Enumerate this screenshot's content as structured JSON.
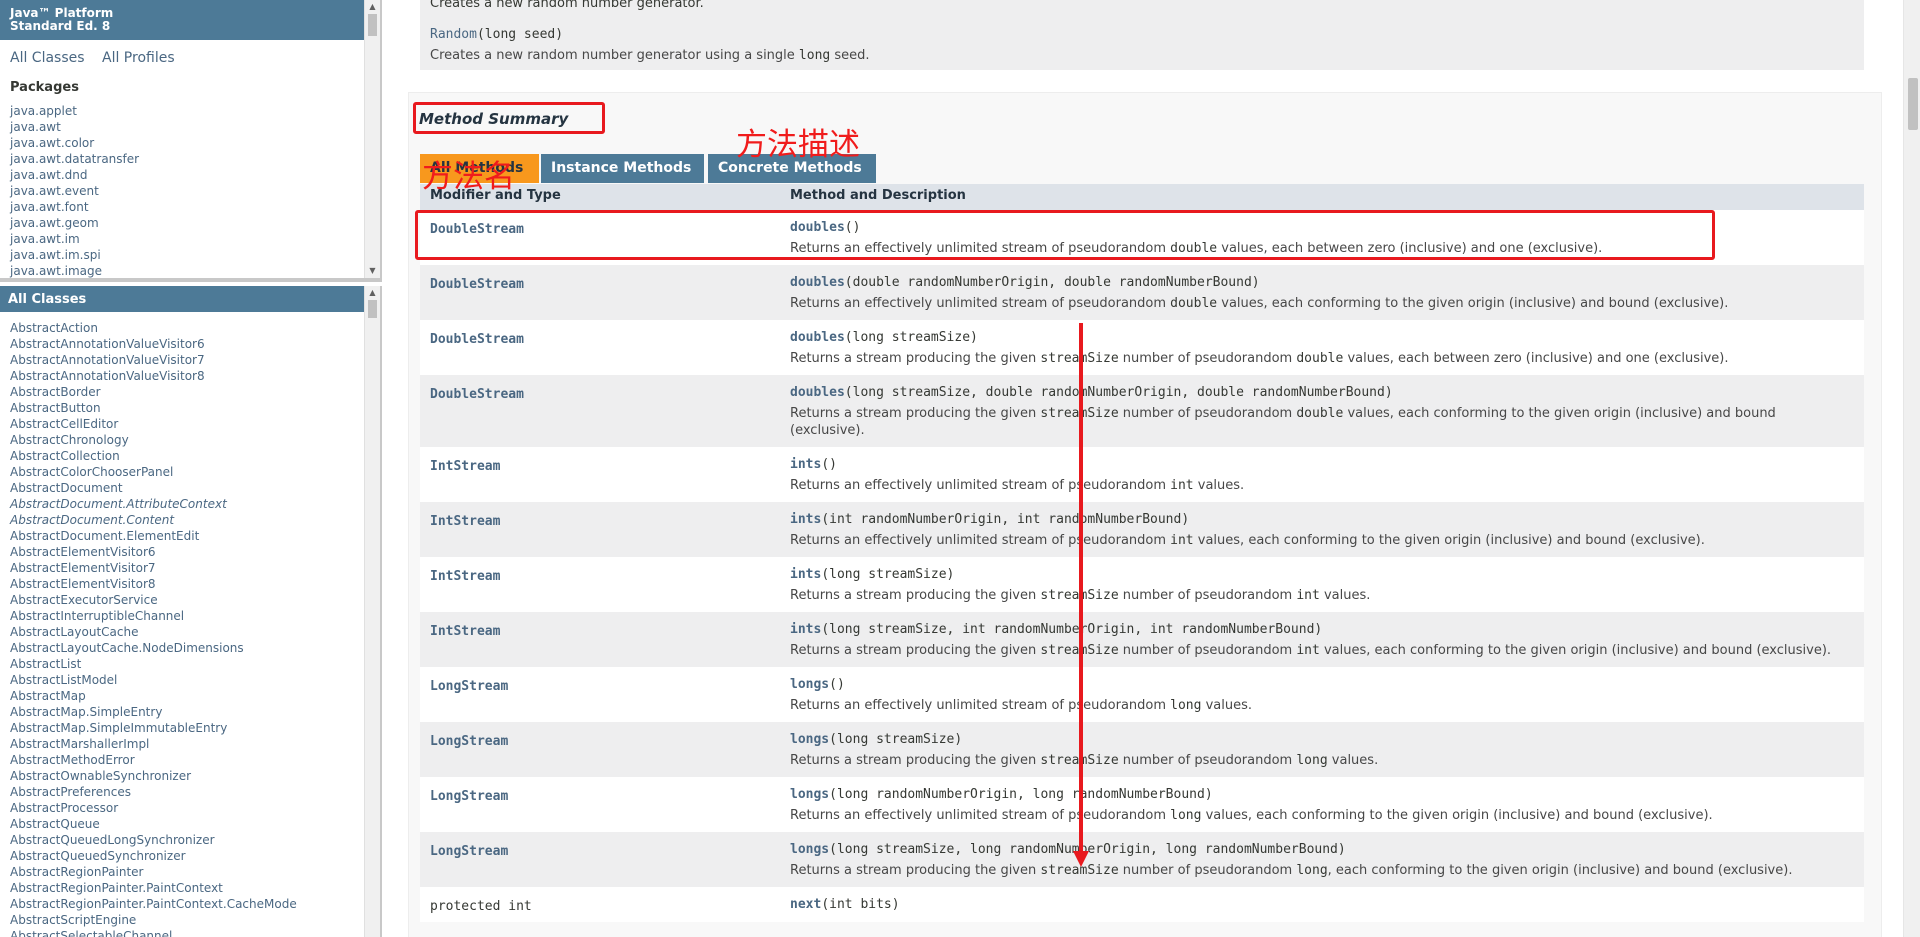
{
  "package_frame": {
    "platform_title_line1": "Java™ Platform",
    "platform_title_line2": "Standard Ed. 8",
    "all_classes_link": "All Classes",
    "all_profiles_link": "All Profiles",
    "packages_heading": "Packages",
    "packages": [
      "java.applet",
      "java.awt",
      "java.awt.color",
      "java.awt.datatransfer",
      "java.awt.dnd",
      "java.awt.event",
      "java.awt.font",
      "java.awt.geom",
      "java.awt.im",
      "java.awt.im.spi",
      "java.awt.image"
    ]
  },
  "class_frame": {
    "heading": "All Classes",
    "classes": [
      {
        "name": "AbstractAction",
        "italic": false
      },
      {
        "name": "AbstractAnnotationValueVisitor6",
        "italic": false
      },
      {
        "name": "AbstractAnnotationValueVisitor7",
        "italic": false
      },
      {
        "name": "AbstractAnnotationValueVisitor8",
        "italic": false
      },
      {
        "name": "AbstractBorder",
        "italic": false
      },
      {
        "name": "AbstractButton",
        "italic": false
      },
      {
        "name": "AbstractCellEditor",
        "italic": false
      },
      {
        "name": "AbstractChronology",
        "italic": false
      },
      {
        "name": "AbstractCollection",
        "italic": false
      },
      {
        "name": "AbstractColorChooserPanel",
        "italic": false
      },
      {
        "name": "AbstractDocument",
        "italic": false
      },
      {
        "name": "AbstractDocument.AttributeContext",
        "italic": true
      },
      {
        "name": "AbstractDocument.Content",
        "italic": true
      },
      {
        "name": "AbstractDocument.ElementEdit",
        "italic": false
      },
      {
        "name": "AbstractElementVisitor6",
        "italic": false
      },
      {
        "name": "AbstractElementVisitor7",
        "italic": false
      },
      {
        "name": "AbstractElementVisitor8",
        "italic": false
      },
      {
        "name": "AbstractExecutorService",
        "italic": false
      },
      {
        "name": "AbstractInterruptibleChannel",
        "italic": false
      },
      {
        "name": "AbstractLayoutCache",
        "italic": false
      },
      {
        "name": "AbstractLayoutCache.NodeDimensions",
        "italic": false
      },
      {
        "name": "AbstractList",
        "italic": false
      },
      {
        "name": "AbstractListModel",
        "italic": false
      },
      {
        "name": "AbstractMap",
        "italic": false
      },
      {
        "name": "AbstractMap.SimpleEntry",
        "italic": false
      },
      {
        "name": "AbstractMap.SimpleImmutableEntry",
        "italic": false
      },
      {
        "name": "AbstractMarshallerImpl",
        "italic": false
      },
      {
        "name": "AbstractMethodError",
        "italic": false
      },
      {
        "name": "AbstractOwnableSynchronizer",
        "italic": false
      },
      {
        "name": "AbstractPreferences",
        "italic": false
      },
      {
        "name": "AbstractProcessor",
        "italic": false
      },
      {
        "name": "AbstractQueue",
        "italic": false
      },
      {
        "name": "AbstractQueuedLongSynchronizer",
        "italic": false
      },
      {
        "name": "AbstractQueuedSynchronizer",
        "italic": false
      },
      {
        "name": "AbstractRegionPainter",
        "italic": false
      },
      {
        "name": "AbstractRegionPainter.PaintContext",
        "italic": false
      },
      {
        "name": "AbstractRegionPainter.PaintContext.CacheMode",
        "italic": false
      },
      {
        "name": "AbstractScriptEngine",
        "italic": false
      },
      {
        "name": "AbstractSelectableChannel",
        "italic": false
      }
    ]
  },
  "constructor": {
    "prev_desc_fragment": "Creates a new random number generator.",
    "name": "Random",
    "params": "(long seed)",
    "desc_before": "Creates a new random number generator using a single ",
    "desc_code": "long",
    "desc_after": " seed."
  },
  "method_summary": {
    "title": "Method Summary",
    "tabs": [
      "All Methods",
      "Instance Methods",
      "Concrete Methods"
    ],
    "col1": "Modifier and Type",
    "col2": "Method and Description",
    "rows": [
      {
        "type": "DoubleStream",
        "name": "doubles",
        "params": "()",
        "desc": "Returns an effectively unlimited stream of pseudorandom double values, each between zero (inclusive) and one (exclusive)."
      },
      {
        "type": "DoubleStream",
        "name": "doubles",
        "params": "(double randomNumberOrigin, double randomNumberBound)",
        "desc": "Returns an effectively unlimited stream of pseudorandom double values, each conforming to the given origin (inclusive) and bound (exclusive)."
      },
      {
        "type": "DoubleStream",
        "name": "doubles",
        "params": "(long streamSize)",
        "desc": "Returns a stream producing the given streamSize number of pseudorandom double values, each between zero (inclusive) and one (exclusive)."
      },
      {
        "type": "DoubleStream",
        "name": "doubles",
        "params": "(long streamSize, double randomNumberOrigin, double randomNumberBound)",
        "desc": "Returns a stream producing the given streamSize number of pseudorandom double values, each conforming to the given origin (inclusive) and bound (exclusive)."
      },
      {
        "type": "IntStream",
        "name": "ints",
        "params": "()",
        "desc": "Returns an effectively unlimited stream of pseudorandom int values."
      },
      {
        "type": "IntStream",
        "name": "ints",
        "params": "(int randomNumberOrigin, int randomNumberBound)",
        "desc": "Returns an effectively unlimited stream of pseudorandom int values, each conforming to the given origin (inclusive) and bound (exclusive)."
      },
      {
        "type": "IntStream",
        "name": "ints",
        "params": "(long streamSize)",
        "desc": "Returns a stream producing the given streamSize number of pseudorandom int values."
      },
      {
        "type": "IntStream",
        "name": "ints",
        "params": "(long streamSize, int randomNumberOrigin, int randomNumberBound)",
        "desc": "Returns a stream producing the given streamSize number of pseudorandom int values, each conforming to the given origin (inclusive) and bound (exclusive)."
      },
      {
        "type": "LongStream",
        "name": "longs",
        "params": "()",
        "desc": "Returns an effectively unlimited stream of pseudorandom long values."
      },
      {
        "type": "LongStream",
        "name": "longs",
        "params": "(long streamSize)",
        "desc": "Returns a stream producing the given streamSize number of pseudorandom long values."
      },
      {
        "type": "LongStream",
        "name": "longs",
        "params": "(long randomNumberOrigin, long randomNumberBound)",
        "desc": "Returns an effectively unlimited stream of pseudorandom long values, each conforming to the given origin (inclusive) and bound (exclusive)."
      },
      {
        "type": "LongStream",
        "name": "longs",
        "params": "(long streamSize, long randomNumberOrigin, long randomNumberBound)",
        "desc": "Returns a stream producing the given streamSize number of pseudorandom long, each conforming to the given origin (inclusive) and bound (exclusive)."
      },
      {
        "type": "protected int",
        "name": "next",
        "params": "(int bits)",
        "desc": ""
      }
    ]
  },
  "annotations": {
    "method_name_label": "方法名",
    "method_desc_label": "方法描述"
  },
  "colors": {
    "header_blue": "#4d7a97",
    "active_tab_orange": "#f8981d",
    "link_blue": "#4a6782",
    "annotation_red": "#e8191e"
  }
}
